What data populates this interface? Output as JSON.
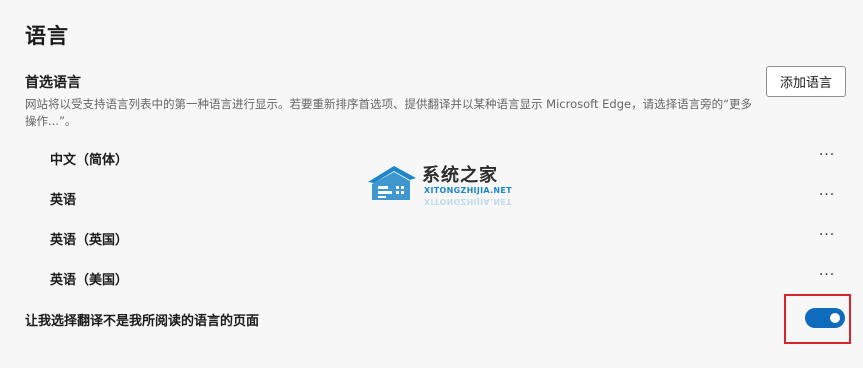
{
  "page": {
    "title": "语言"
  },
  "preferred_languages": {
    "title": "首选语言",
    "description": "网站将以受支持语言列表中的第一种语言进行显示。若要重新排序首选项、提供翻译并以某种语言显示 Microsoft Edge，请选择语言旁的“更多操作...”。",
    "add_button_label": "添加语言",
    "more_actions_label": "···",
    "languages": [
      {
        "name": "中文（简体）"
      },
      {
        "name": "英语"
      },
      {
        "name": "英语（英国）"
      },
      {
        "name": "英语（美国）"
      }
    ]
  },
  "translate_offer": {
    "label": "让我选择翻译不是我所阅读的语言的页面",
    "enabled": true,
    "accent_color": "#0f6cbd"
  },
  "highlight": {
    "color": "#d9232a"
  },
  "watermark": {
    "name": "系统之家",
    "url": "XITONGZHIJIA.NET"
  }
}
